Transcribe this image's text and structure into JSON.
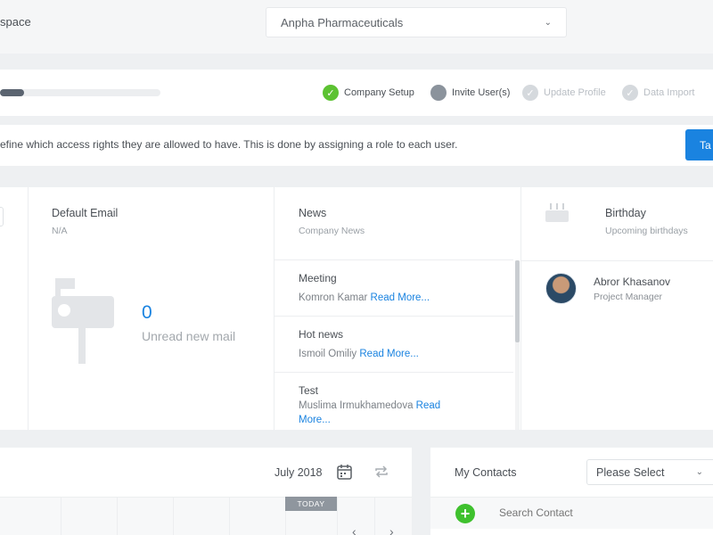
{
  "header": {
    "workspace_label": "space",
    "company": "Anpha Pharmaceuticals"
  },
  "progress": {
    "fraction": 0.15,
    "steps": [
      {
        "label": "Company Setup",
        "state": "done"
      },
      {
        "label": "Invite User(s)",
        "state": "current"
      },
      {
        "label": "Update Profile",
        "state": "todo"
      },
      {
        "label": "Data Import",
        "state": "todo"
      }
    ]
  },
  "banner": {
    "text": "efine which access rights they are allowed to have. This is done by assigning a role to each user.",
    "button_label": "Ta"
  },
  "email_widget": {
    "title": "Default Email",
    "subtitle": "N/A",
    "count": "0",
    "count_label": "Unread new mail"
  },
  "news_widget": {
    "title": "News",
    "subtitle": "Company News",
    "items": [
      {
        "title": "Meeting",
        "author": "Komron Kamar",
        "link": "Read More..."
      },
      {
        "title": "Hot news",
        "author": "Ismoil Omiliy",
        "link": "Read More..."
      },
      {
        "title": "Test",
        "author": "Muslima Irmukhamedova",
        "link": "Read More..."
      }
    ]
  },
  "birthday_widget": {
    "title": "Birthday",
    "subtitle": "Upcoming birthdays",
    "people": [
      {
        "name": "Abror Khasanov",
        "role": "Project Manager"
      }
    ]
  },
  "calendar": {
    "month": "July 2018",
    "today_label": "TODAY"
  },
  "contacts": {
    "title": "My Contacts",
    "select_value": "Please Select",
    "search_placeholder": "Search Contact"
  },
  "colors": {
    "accent": "#1a83e0",
    "success": "#5cc232",
    "add_green": "#3fc12e"
  },
  "icons": [
    "check-icon",
    "chevron-down-icon",
    "mailbox-icon",
    "cake-icon",
    "calendar-icon",
    "repeat-icon",
    "plus-icon"
  ]
}
